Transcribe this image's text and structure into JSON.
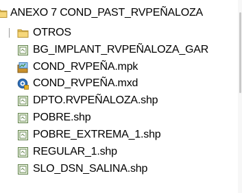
{
  "tree": {
    "root": {
      "label": "ANEXO 7 COND_PAST_RVPEÑALOZA",
      "icon": "folder-icon"
    },
    "items": [
      {
        "label": "OTROS",
        "icon": "folder-icon"
      },
      {
        "label": "BG_IMPLANT_RVPEÑALOZA_GAR",
        "icon": "shapefile-icon"
      },
      {
        "label": "COND_RVPEÑA.mpk",
        "icon": "map-package-icon"
      },
      {
        "label": "COND_RVPEÑA.mxd",
        "icon": "map-document-icon"
      },
      {
        "label": "DPTO.RVPEÑALOZA.shp",
        "icon": "shapefile-icon"
      },
      {
        "label": "POBRE.shp",
        "icon": "shapefile-icon"
      },
      {
        "label": "POBRE_EXTREMA_1.shp",
        "icon": "shapefile-icon"
      },
      {
        "label": "REGULAR_1.shp",
        "icon": "shapefile-icon"
      },
      {
        "label": "SLO_DSN_SALINA.shp",
        "icon": "shapefile-icon"
      }
    ]
  }
}
